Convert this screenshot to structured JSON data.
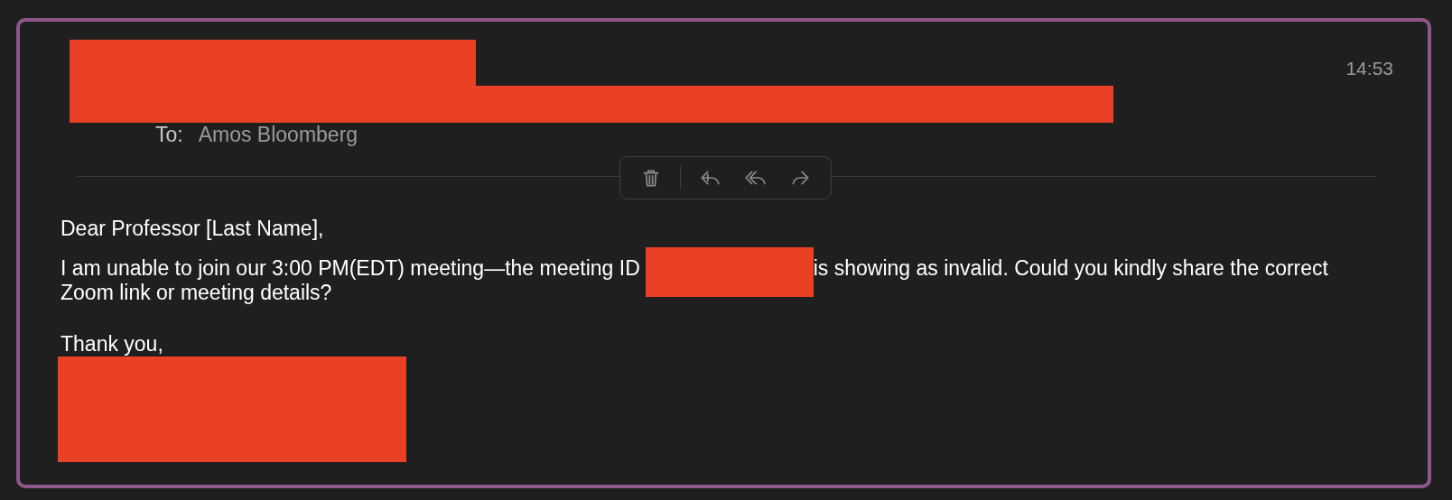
{
  "message": {
    "time": "14:53",
    "to_label": "To:",
    "to_name": "Amos Bloomberg"
  },
  "toolbar": [
    {
      "kind": "trash"
    },
    {
      "kind": "reply"
    },
    {
      "kind": "reply_all"
    },
    {
      "kind": "forward"
    }
  ],
  "body": {
    "greeting": "Dear Professor [Last Name],",
    "paragraph_before": "I am unable to join our 3:00 PM(EDT) meeting—the meeting ID",
    "paragraph_after": "is showing as invalid. Could you kindly share the correct",
    "paragraph_end": "Zoom link or meeting details?",
    "closing": "Thank you,"
  }
}
